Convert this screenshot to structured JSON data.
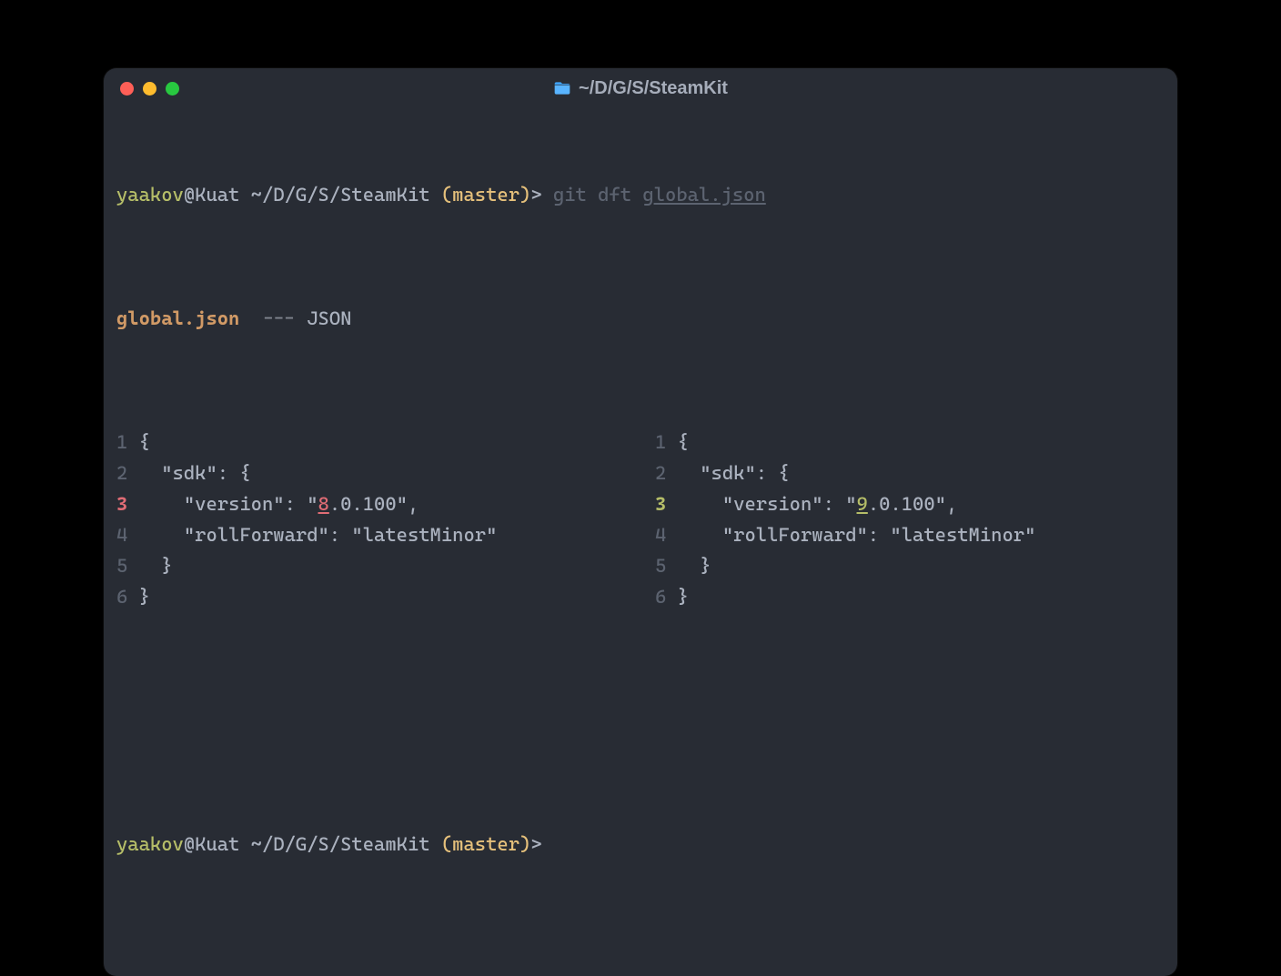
{
  "window": {
    "title": "~/D/G/S/SteamKit"
  },
  "prompt1": {
    "user": "yaakov",
    "at": "@",
    "host": "Kuat",
    "path": "~/D/G/S/SteamKit",
    "branch_open": "(",
    "branch": "master",
    "branch_close": ")",
    "gt": ">",
    "cmd_git": "git",
    "cmd_sub": "dft",
    "cmd_arg": "global.json"
  },
  "fileheader": {
    "name": "global.json",
    "dashes": "---",
    "type": "JSON"
  },
  "left": {
    "l1_num": "1",
    "l1_code": "{",
    "l2_num": "2",
    "l2_code": "  \"sdk\": {",
    "l3_num": "3",
    "l3_pre": "    \"version\": \"",
    "l3_hl": "8",
    "l3_post": ".0.100\",",
    "l4_num": "4",
    "l4_code": "    \"rollForward\": \"latestMinor\"",
    "l5_num": "5",
    "l5_code": "  }",
    "l6_num": "6",
    "l6_code": "}"
  },
  "right": {
    "l1_num": "1",
    "l1_code": "{",
    "l2_num": "2",
    "l2_code": "  \"sdk\": {",
    "l3_num": "3",
    "l3_pre": "    \"version\": \"",
    "l3_hl": "9",
    "l3_post": ".0.100\",",
    "l4_num": "4",
    "l4_code": "    \"rollForward\": \"latestMinor\"",
    "l5_num": "5",
    "l5_code": "  }",
    "l6_num": "6",
    "l6_code": "}"
  },
  "prompt2": {
    "user": "yaakov",
    "at": "@",
    "host": "Kuat",
    "path": "~/D/G/S/SteamKit",
    "branch_open": "(",
    "branch": "master",
    "branch_close": ")",
    "gt": ">"
  }
}
